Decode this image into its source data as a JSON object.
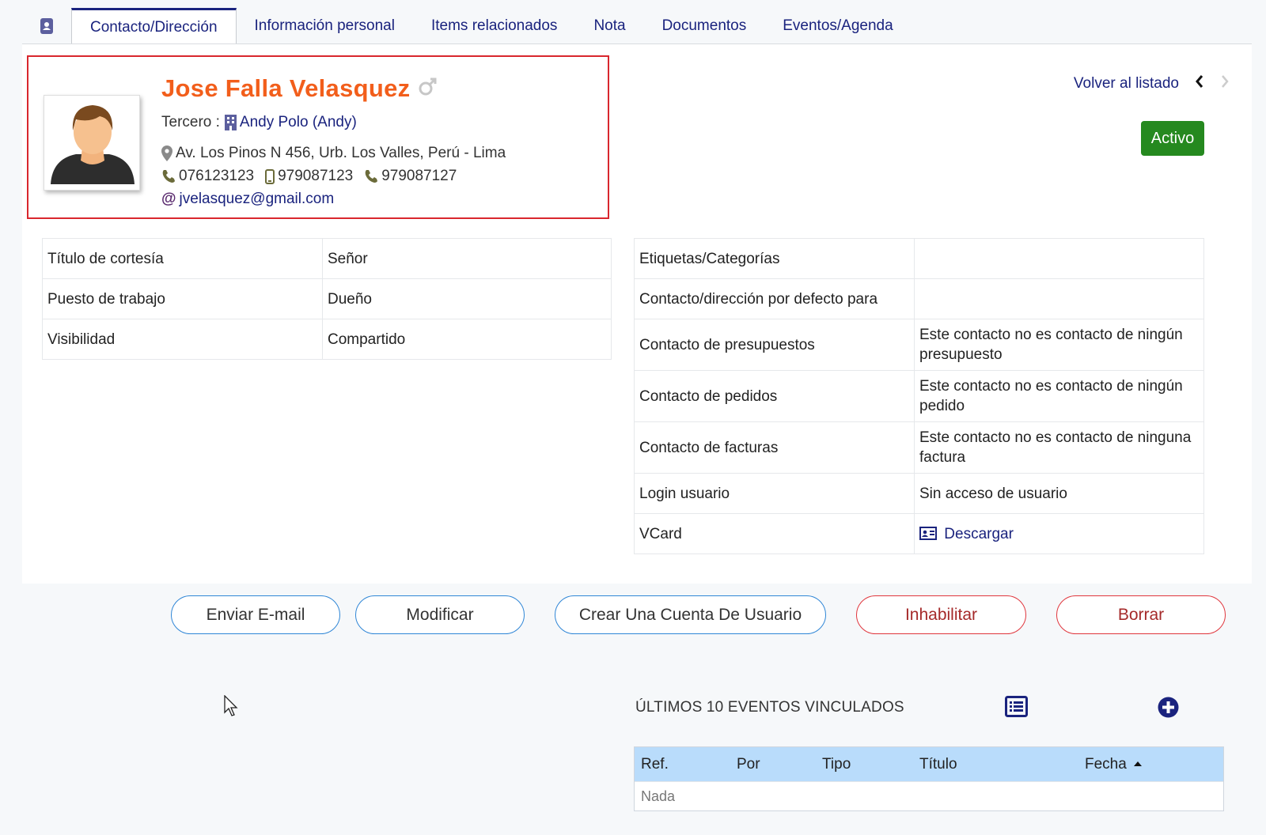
{
  "tabs": {
    "items": [
      "Contacto/Dirección",
      "Información personal",
      "Items relacionados",
      "Nota",
      "Documentos",
      "Eventos/Agenda"
    ],
    "active": 0
  },
  "contact": {
    "name": "Jose Falla Velasquez",
    "gender_icon": "male-icon",
    "third_party_label": "Tercero :",
    "third_party": "Andy Polo (Andy)",
    "address": "Av. Los Pinos N 456, Urb. Los Valles, Perú - Lima",
    "phone_office": "076123123",
    "phone_mobile": "979087123",
    "phone_other": "979087127",
    "email": "jvelasquez@gmail.com"
  },
  "nav": {
    "back": "Volver al listado"
  },
  "status": {
    "label": "Activo",
    "color": "#25891f"
  },
  "left_table": [
    {
      "label": "Título de cortesía",
      "value": "Señor"
    },
    {
      "label": "Puesto de trabajo",
      "value": "Dueño"
    },
    {
      "label": "Visibilidad",
      "value": "Compartido"
    }
  ],
  "right_table": {
    "tags_label": "Etiquetas/Categorías",
    "tags_value": "",
    "default_label": "Contacto/dirección por defecto para",
    "default_value": "",
    "quotes_label": "Contacto de presupuestos",
    "quotes_value": "Este contacto no es contacto de ningún presupuesto",
    "orders_label": "Contacto de pedidos",
    "orders_value": "Este contacto no es contacto de ningún pedido",
    "invoices_label": "Contacto de facturas",
    "invoices_value": "Este contacto no es contacto de ninguna factura",
    "login_label": "Login usuario",
    "login_value": "Sin acceso de usuario",
    "vcard_label": "VCard",
    "vcard_link": "Descargar"
  },
  "actions": {
    "send_email": "Enviar E-mail",
    "modify": "Modificar",
    "create_user": "Crear Una Cuenta De Usuario",
    "disable": "Inhabilitar",
    "delete": "Borrar"
  },
  "events": {
    "title": "ÚLTIMOS 10 EVENTOS VINCULADOS",
    "columns": [
      "Ref.",
      "Por",
      "Tipo",
      "Título",
      "Fecha"
    ],
    "empty": "Nada"
  },
  "colors": {
    "accent": "#1a237e",
    "name": "#f25e1b",
    "danger": "#e0363d",
    "primary_border": "#2f86d6",
    "table_header": "#b9dcfb"
  }
}
